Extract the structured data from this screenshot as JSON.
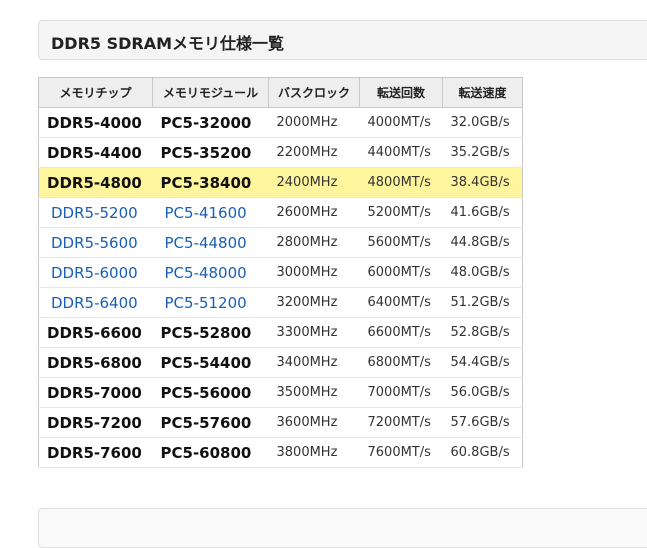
{
  "section": {
    "title": "DDR5 SDRAMメモリ仕様一覧"
  },
  "table": {
    "headers": [
      "メモリチップ",
      "メモリモジュール",
      "バスクロック",
      "転送回数",
      "転送速度"
    ],
    "rows": [
      {
        "chip": "DDR5-4000",
        "module": "PC5-32000",
        "clock": "2000MHz",
        "transfers": "4000MT/s",
        "speed": "32.0GB/s",
        "style": "strong",
        "highlight": false
      },
      {
        "chip": "DDR5-4400",
        "module": "PC5-35200",
        "clock": "2200MHz",
        "transfers": "4400MT/s",
        "speed": "35.2GB/s",
        "style": "strong",
        "highlight": false
      },
      {
        "chip": "DDR5-4800",
        "module": "PC5-38400",
        "clock": "2400MHz",
        "transfers": "4800MT/s",
        "speed": "38.4GB/s",
        "style": "strong",
        "highlight": true
      },
      {
        "chip": "DDR5-5200",
        "module": "PC5-41600",
        "clock": "2600MHz",
        "transfers": "5200MT/s",
        "speed": "41.6GB/s",
        "style": "link",
        "highlight": false
      },
      {
        "chip": "DDR5-5600",
        "module": "PC5-44800",
        "clock": "2800MHz",
        "transfers": "5600MT/s",
        "speed": "44.8GB/s",
        "style": "link",
        "highlight": false
      },
      {
        "chip": "DDR5-6000",
        "module": "PC5-48000",
        "clock": "3000MHz",
        "transfers": "6000MT/s",
        "speed": "48.0GB/s",
        "style": "link",
        "highlight": false
      },
      {
        "chip": "DDR5-6400",
        "module": "PC5-51200",
        "clock": "3200MHz",
        "transfers": "6400MT/s",
        "speed": "51.2GB/s",
        "style": "link",
        "highlight": false
      },
      {
        "chip": "DDR5-6600",
        "module": "PC5-52800",
        "clock": "3300MHz",
        "transfers": "6600MT/s",
        "speed": "52.8GB/s",
        "style": "strong",
        "highlight": false
      },
      {
        "chip": "DDR5-6800",
        "module": "PC5-54400",
        "clock": "3400MHz",
        "transfers": "6800MT/s",
        "speed": "54.4GB/s",
        "style": "strong",
        "highlight": false
      },
      {
        "chip": "DDR5-7000",
        "module": "PC5-56000",
        "clock": "3500MHz",
        "transfers": "7000MT/s",
        "speed": "56.0GB/s",
        "style": "strong",
        "highlight": false
      },
      {
        "chip": "DDR5-7200",
        "module": "PC5-57600",
        "clock": "3600MHz",
        "transfers": "7200MT/s",
        "speed": "57.6GB/s",
        "style": "strong",
        "highlight": false
      },
      {
        "chip": "DDR5-7600",
        "module": "PC5-60800",
        "clock": "3800MHz",
        "transfers": "7600MT/s",
        "speed": "60.8GB/s",
        "style": "strong",
        "highlight": false
      }
    ]
  },
  "colors": {
    "highlight": "#fff59d",
    "link": "#1a5fb4",
    "header_bg": "#eeeeee"
  }
}
